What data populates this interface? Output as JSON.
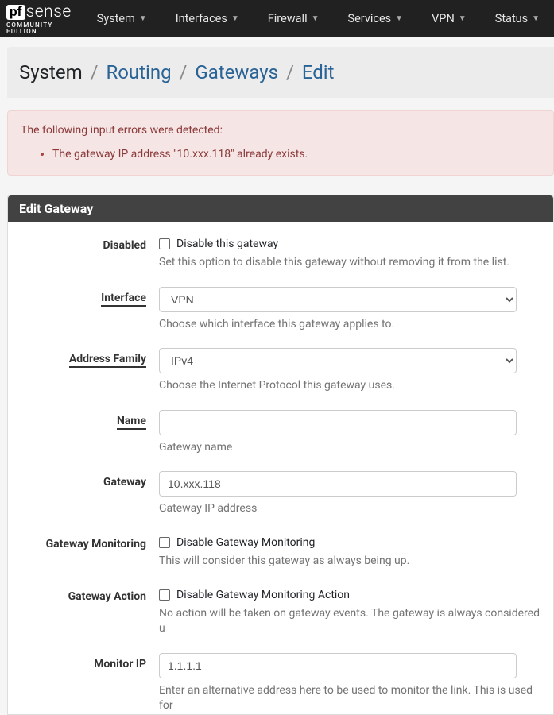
{
  "logo": {
    "prefix": "pf",
    "suffix": "sense",
    "subtitle": "COMMUNITY EDITION"
  },
  "nav": {
    "items": [
      {
        "label": "System"
      },
      {
        "label": "Interfaces"
      },
      {
        "label": "Firewall"
      },
      {
        "label": "Services"
      },
      {
        "label": "VPN"
      },
      {
        "label": "Status"
      }
    ]
  },
  "breadcrumb": {
    "root": "System",
    "section": "Routing",
    "page": "Gateways",
    "action": "Edit"
  },
  "alert": {
    "heading": "The following input errors were detected:",
    "items": [
      "The gateway IP address \"10.xxx.118\" already exists."
    ]
  },
  "panel": {
    "title": "Edit Gateway"
  },
  "form": {
    "disabled": {
      "label": "Disabled",
      "checkbox_label": "Disable this gateway",
      "help": "Set this option to disable this gateway without removing it from the list."
    },
    "interface": {
      "label": "Interface",
      "value": "VPN",
      "help": "Choose which interface this gateway applies to."
    },
    "address_family": {
      "label": "Address Family",
      "value": "IPv4",
      "help": "Choose the Internet Protocol this gateway uses."
    },
    "name": {
      "label": "Name",
      "value": "",
      "help": "Gateway name"
    },
    "gateway": {
      "label": "Gateway",
      "value": "10.xxx.118",
      "help": "Gateway IP address"
    },
    "gateway_monitoring": {
      "label": "Gateway Monitoring",
      "checkbox_label": "Disable Gateway Monitoring",
      "help": "This will consider this gateway as always being up."
    },
    "gateway_action": {
      "label": "Gateway Action",
      "checkbox_label": "Disable Gateway Monitoring Action",
      "help": "No action will be taken on gateway events. The gateway is always considered u"
    },
    "monitor_ip": {
      "label": "Monitor IP",
      "value": "1.1.1.1",
      "help": "Enter an alternative address here to be used to monitor the link. This is used for"
    }
  }
}
